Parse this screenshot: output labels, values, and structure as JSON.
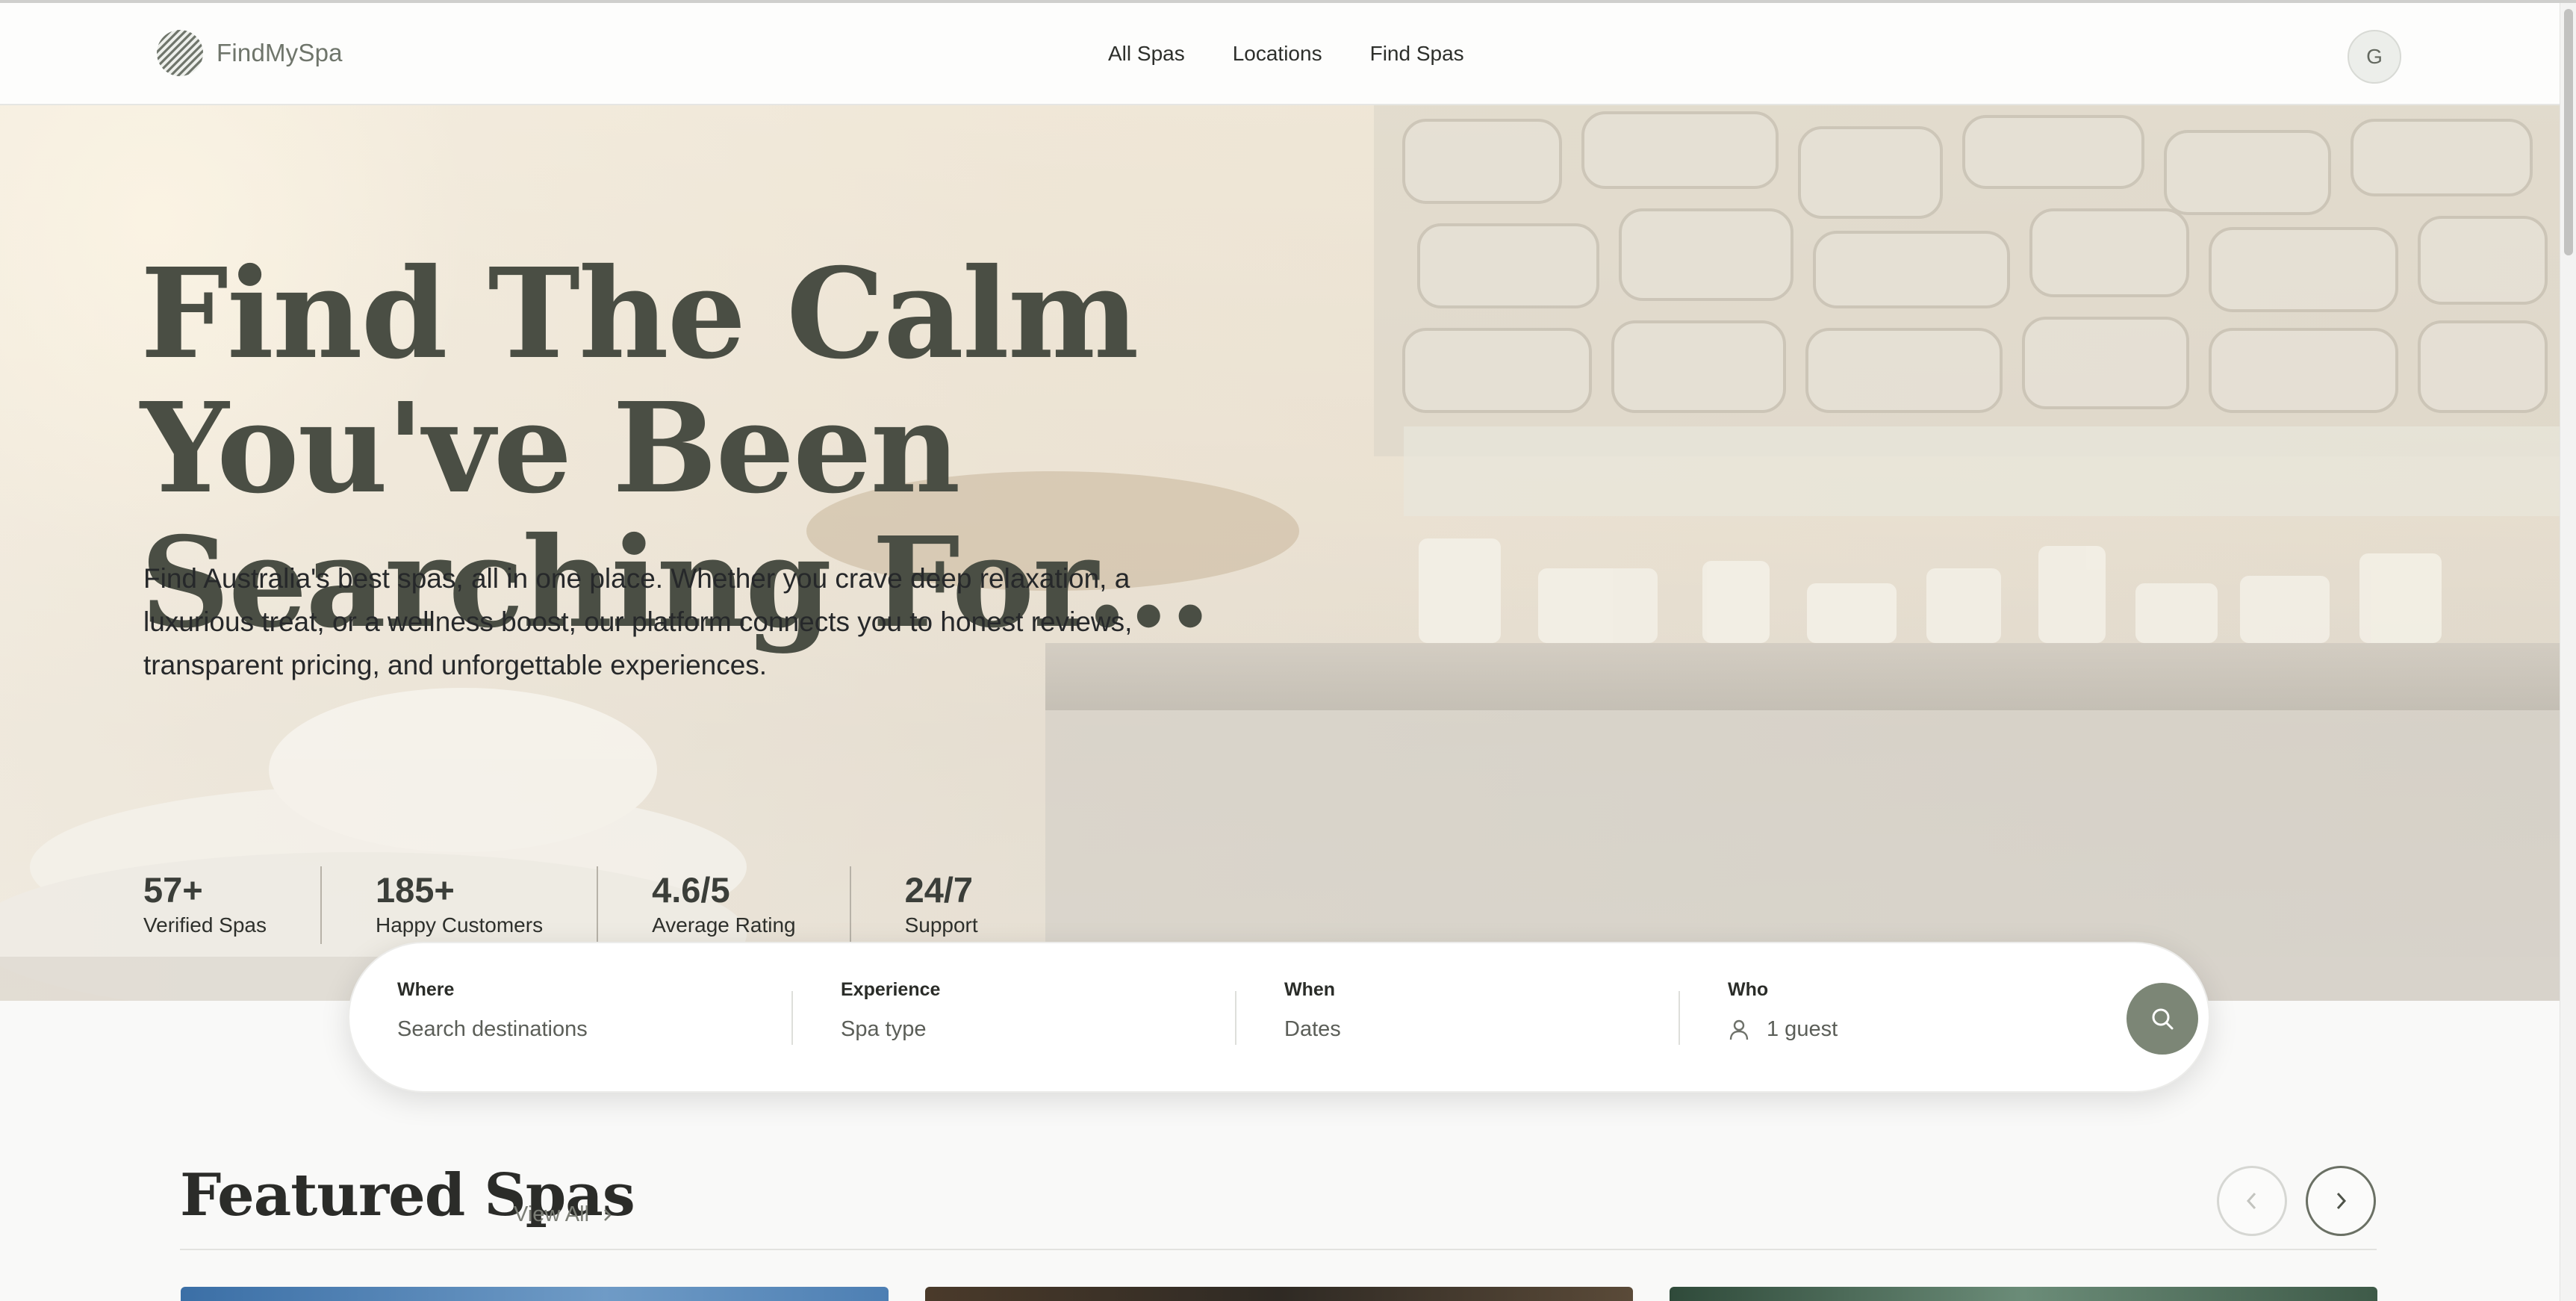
{
  "app": {
    "brand": "FindMySpa"
  },
  "header": {
    "nav": [
      {
        "label": "All Spas"
      },
      {
        "label": "Locations"
      },
      {
        "label": "Find Spas"
      }
    ],
    "avatar_initial": "G"
  },
  "hero": {
    "title_line1": "Find The Calm You've Been",
    "title_line2": "Searching For...",
    "description": "Find Australia's best spas, all in one place. Whether you crave deep relaxation, a luxurious treat, or a wellness boost, our platform connects you to honest reviews, transparent pricing, and unforgettable experiences.",
    "stats": [
      {
        "value": "57+",
        "label": "Verified Spas"
      },
      {
        "value": "185+",
        "label": "Happy Customers"
      },
      {
        "value": "4.6/5",
        "label": "Average Rating"
      },
      {
        "value": "24/7",
        "label": "Support"
      }
    ]
  },
  "search": {
    "where": {
      "label": "Where",
      "placeholder": "Search destinations"
    },
    "experience": {
      "label": "Experience",
      "placeholder": "Spa type"
    },
    "when": {
      "label": "When",
      "placeholder": "Dates"
    },
    "who": {
      "label": "Who",
      "value": "1 guest"
    }
  },
  "featured": {
    "title": "Featured Spas",
    "view_all": "View All"
  },
  "colors": {
    "accent": "#7c8676",
    "heading": "#4a4e44",
    "text": "#2f302c"
  },
  "icons": [
    "logo-stripes-icon",
    "search-icon",
    "person-icon",
    "chevron-right-icon",
    "chevron-left-icon"
  ]
}
